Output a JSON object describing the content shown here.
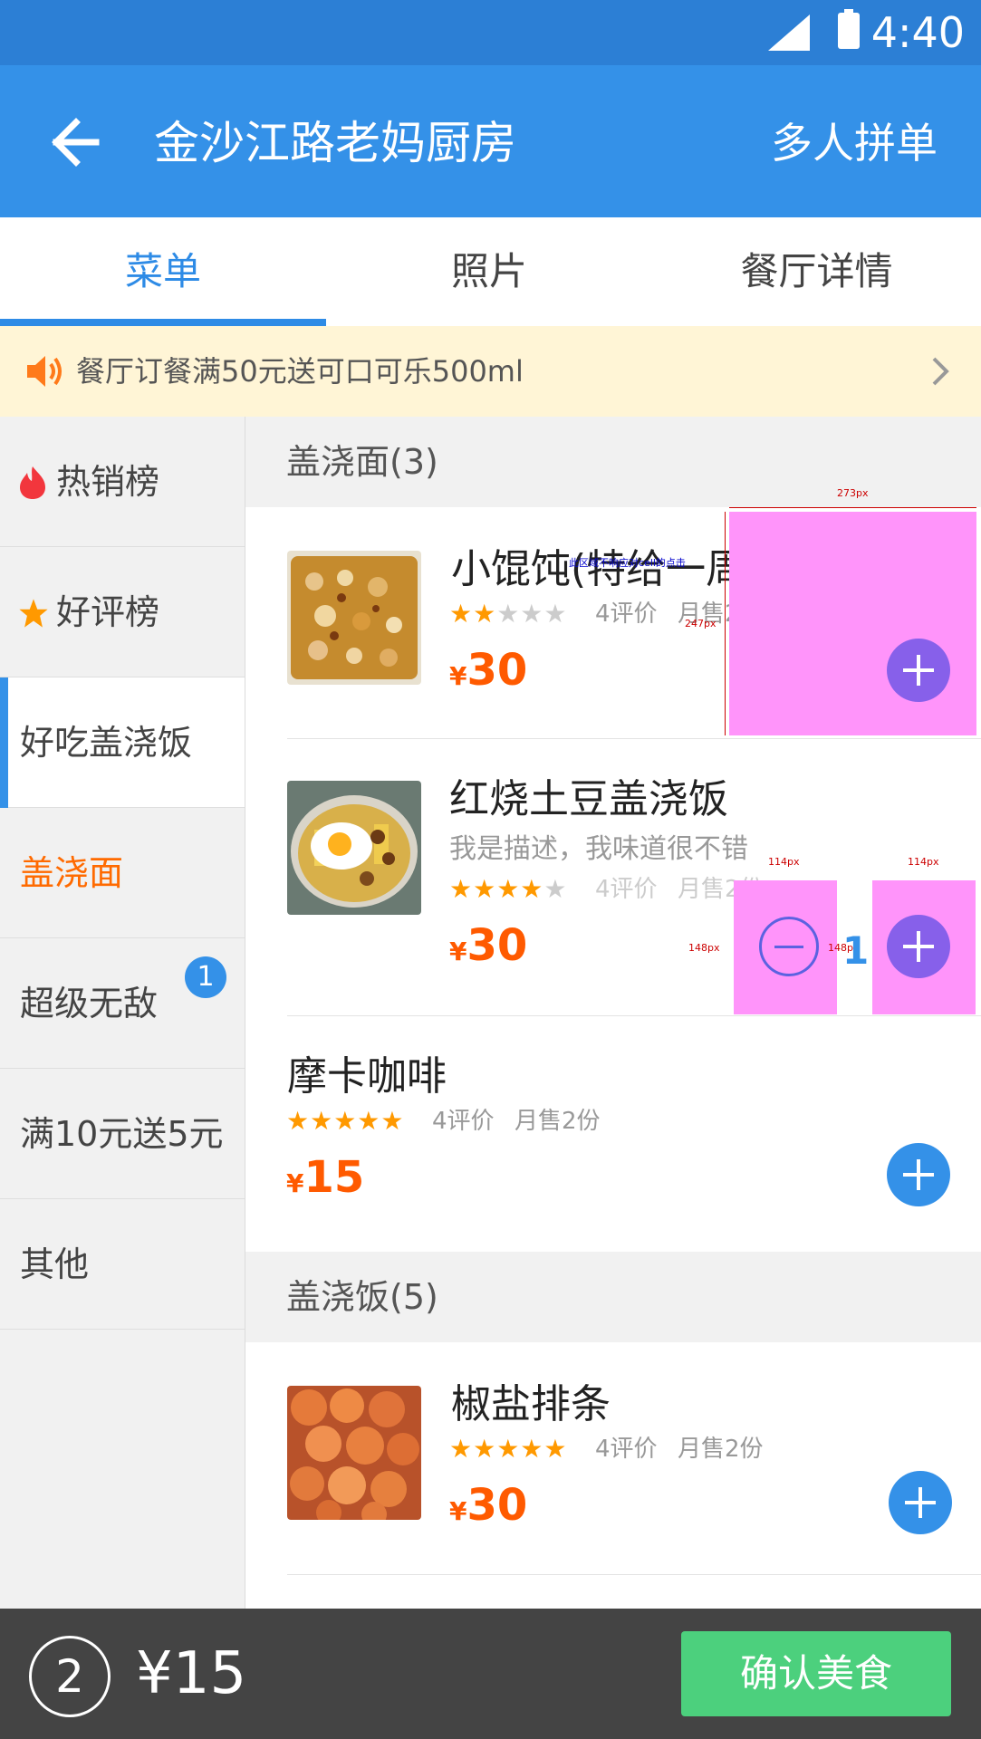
{
  "status_bar": {
    "time": "4:40"
  },
  "header": {
    "title": "金沙江路老妈厨房",
    "multi_order": "多人拼单"
  },
  "tabs": [
    {
      "label": "菜单"
    },
    {
      "label": "照片"
    },
    {
      "label": "餐厅详情"
    }
  ],
  "promo": {
    "text": "餐厅订餐满50元送可口可乐500ml"
  },
  "sidebar": {
    "items": [
      {
        "label": "热销榜",
        "icon": "fire-icon"
      },
      {
        "label": "好评榜",
        "icon": "star-icon"
      },
      {
        "label": "好吃盖浇饭"
      },
      {
        "label": "盖浇面"
      },
      {
        "label": "超级无敌",
        "badge": "1"
      },
      {
        "label": "满10元送5元"
      },
      {
        "label": "其他"
      }
    ]
  },
  "sections": [
    {
      "label": "盖浇面(3)"
    },
    {
      "label": "盖浇饭(5)"
    }
  ],
  "dishes": [
    {
      "name": "小馄饨(特给一周)",
      "rating": 2,
      "reviews": "4评价",
      "sales": "月售2份",
      "currency": "¥",
      "price": "30"
    },
    {
      "name": "红烧土豆盖浇饭",
      "desc": "我是描述，我味道很不错",
      "rating": 4,
      "reviews": "4评价",
      "sales": "月售2份",
      "currency": "¥",
      "price": "30",
      "quantity": "1"
    },
    {
      "name": "摩卡咖啡",
      "rating": 5,
      "reviews": "4评价",
      "sales": "月售2份",
      "currency": "¥",
      "price": "15"
    },
    {
      "name": "椒盐排条",
      "rating": 5,
      "reviews": "4评价",
      "sales": "月售2份",
      "currency": "¥",
      "price": "30"
    }
  ],
  "annotations": {
    "width_273": "273px",
    "height_247": "247px",
    "note": "此区域不响应对cell的点击",
    "width_114a": "114px",
    "width_114b": "114px",
    "height_148a": "148px",
    "height_148b": "148px"
  },
  "cart": {
    "count": "2",
    "total": "¥15",
    "confirm": "确认美食"
  },
  "colors": {
    "primary": "#3491E8",
    "price": "#FF5A00",
    "confirm": "#4CD07D",
    "hit_area": "#FF94FA"
  }
}
